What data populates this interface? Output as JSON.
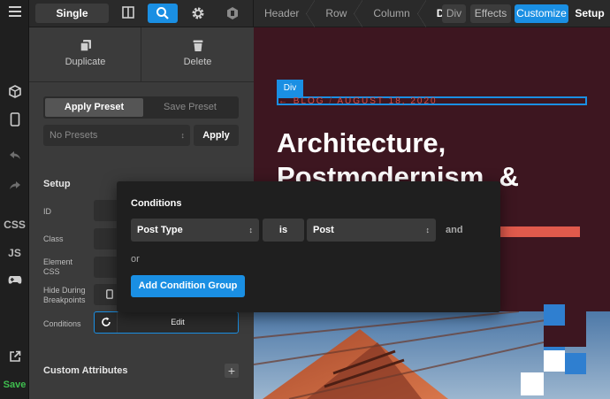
{
  "topbar": {
    "single_label": "Single",
    "breadcrumbs": [
      "Header",
      "Row",
      "Column",
      "Div"
    ],
    "tabs": {
      "div": "Div",
      "effects": "Effects",
      "customize": "Customize",
      "setup": "Setup"
    }
  },
  "rail": {
    "css": "CSS",
    "js": "JS",
    "save": "Save"
  },
  "panel": {
    "duplicate": "Duplicate",
    "delete": "Delete",
    "apply_preset": "Apply Preset",
    "save_preset": "Save Preset",
    "no_presets": "No Presets",
    "apply": "Apply",
    "setup_title": "Setup",
    "fields": {
      "id": "ID",
      "class": "Class",
      "element_css_1": "Element",
      "element_css_2": "CSS",
      "hide_1": "Hide During",
      "hide_2": "Breakpoints",
      "conditions": "Conditions"
    },
    "edit": "Edit",
    "custom_attributes": "Custom Attributes"
  },
  "preview": {
    "div_tag": "Div",
    "meta_blog": "BLOG",
    "meta_sep": "/",
    "meta_date": "AUGUST 18, 2020",
    "headline_1": "Architecture,",
    "headline_2": "Postmodernism, &"
  },
  "modal": {
    "title": "Conditions",
    "condition": {
      "field": "Post Type",
      "operator": "is",
      "value": "Post"
    },
    "and": "and",
    "or": "or",
    "add_group": "Add Condition Group"
  },
  "colors": {
    "accent": "#1a8fe3",
    "preview_bg": "#3d1620",
    "meta_red": "#d34f46",
    "bar_red": "#e05a4c",
    "save_green": "#3fbf4f"
  }
}
